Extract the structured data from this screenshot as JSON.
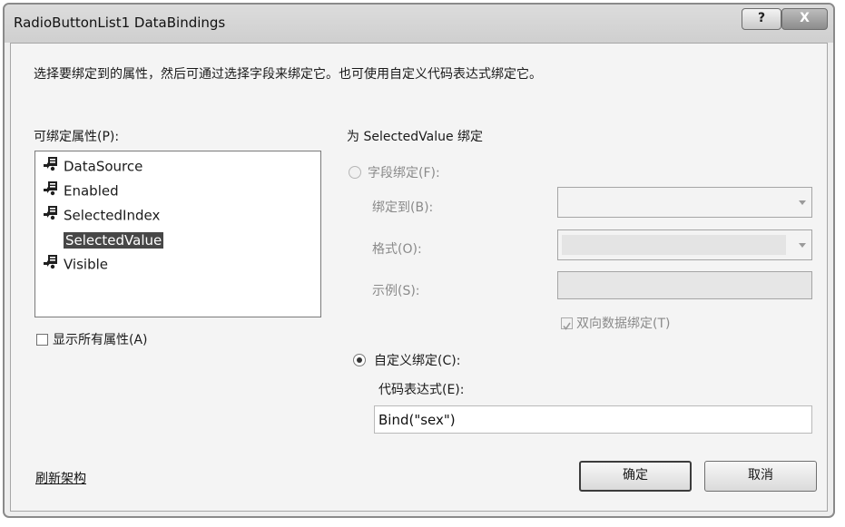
{
  "window": {
    "title": "RadioButtonList1 DataBindings",
    "help_label": "?",
    "close_label": "X"
  },
  "instruction": "选择要绑定到的属性，然后可通过选择字段来绑定它。也可使用自定义代码表达式绑定它。",
  "bindable": {
    "label": "可绑定属性(P):",
    "items": [
      {
        "label": "DataSource",
        "icon": "bindable-property-icon",
        "selected": false
      },
      {
        "label": "Enabled",
        "icon": "bindable-property-icon",
        "selected": false
      },
      {
        "label": "SelectedIndex",
        "icon": "bindable-property-icon",
        "selected": false
      },
      {
        "label": "SelectedValue",
        "icon": "",
        "selected": true
      },
      {
        "label": "Visible",
        "icon": "bindable-property-icon",
        "selected": false
      }
    ],
    "show_all_label": "显示所有属性(A)",
    "show_all_checked": false
  },
  "binding": {
    "header": "为 SelectedValue 绑定",
    "field_binding": {
      "label": "字段绑定(F):",
      "checked": false,
      "enabled": false,
      "bind_to_label": "绑定到(B):",
      "bind_to_value": "",
      "format_label": "格式(O):",
      "format_value": "",
      "sample_label": "示例(S):",
      "sample_value": "",
      "two_way_label": "双向数据绑定(T)",
      "two_way_checked": true
    },
    "custom_binding": {
      "label": "自定义绑定(C):",
      "checked": true,
      "code_label": "代码表达式(E):",
      "code_value": "Bind(\"sex\")"
    }
  },
  "footer": {
    "refresh_link": "刷新架构",
    "ok_label": "确定",
    "cancel_label": "取消"
  }
}
